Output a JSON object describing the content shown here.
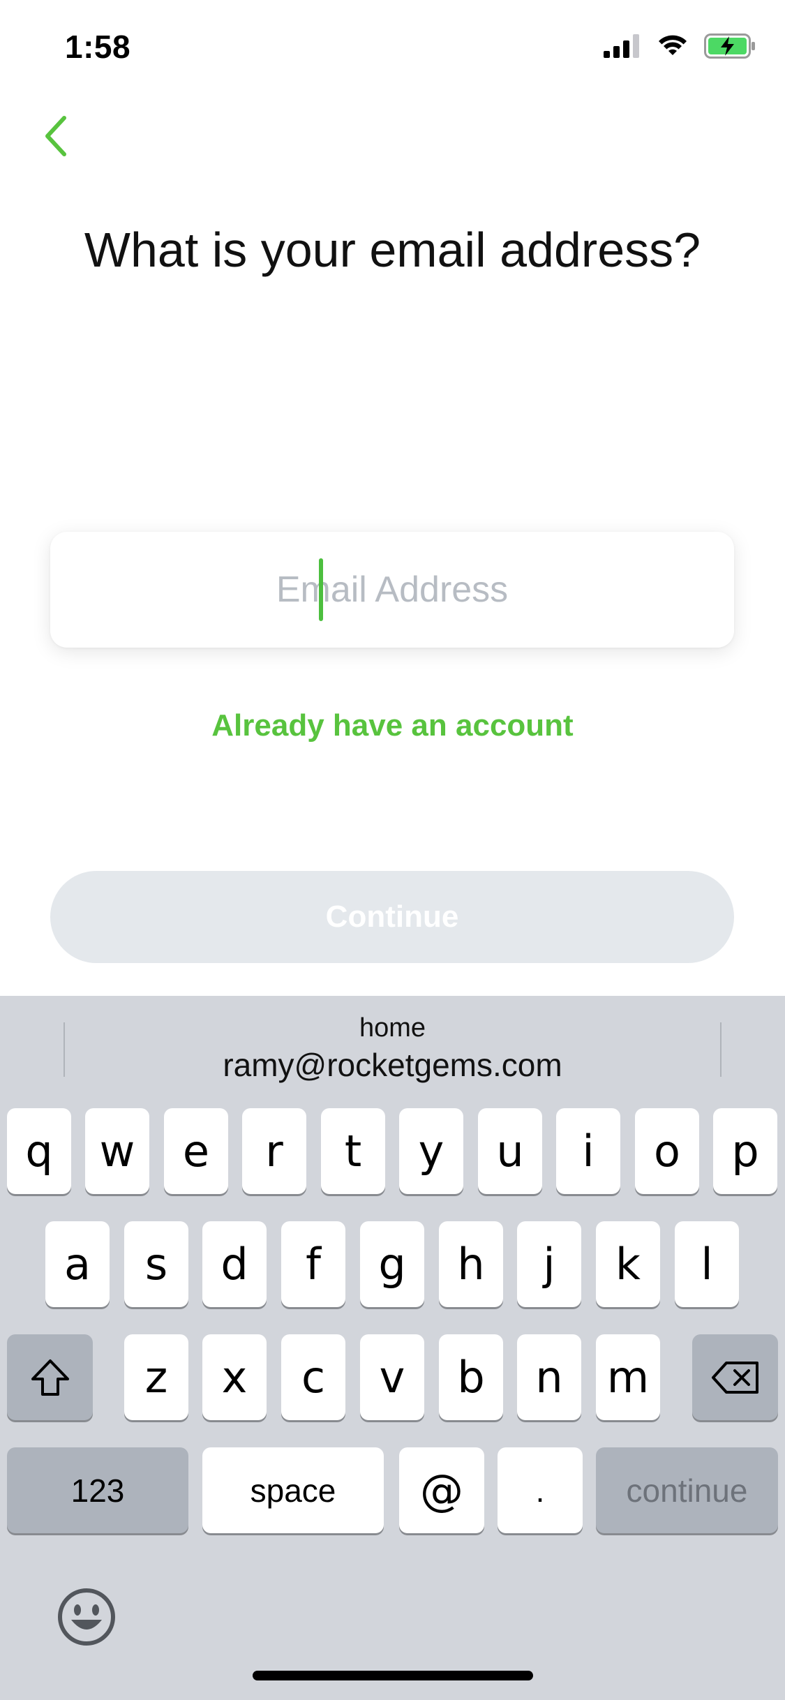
{
  "status_bar": {
    "time": "1:58"
  },
  "title": "What is your email address?",
  "email": {
    "placeholder": "Email Address",
    "value": ""
  },
  "already_link": "Already have an account",
  "continue_button": "Continue",
  "keyboard": {
    "suggestion_label": "home",
    "suggestion_value": "ramy@rocketgems.com",
    "row1": [
      "q",
      "w",
      "e",
      "r",
      "t",
      "y",
      "u",
      "i",
      "o",
      "p"
    ],
    "row2": [
      "a",
      "s",
      "d",
      "f",
      "g",
      "h",
      "j",
      "k",
      "l"
    ],
    "row3": [
      "z",
      "x",
      "c",
      "v",
      "b",
      "n",
      "m"
    ],
    "numbers_key": "123",
    "space_key": "space",
    "at_key": "@",
    "dot_key": ".",
    "return_key": "continue"
  },
  "colors": {
    "accent": "#58c33e",
    "keyboard_bg": "#d2d5db",
    "dark_key": "#adb3bc"
  }
}
